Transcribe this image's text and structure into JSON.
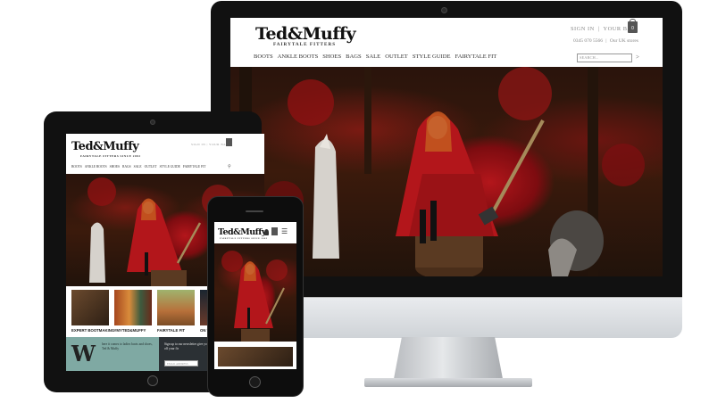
{
  "brand": {
    "logo": "Ted&Muffy",
    "tagline_desktop": "FAIRYTALE FITTERS",
    "tagline_tablet": "FAIRYTALE FITTERS SINCE 2002"
  },
  "desktop": {
    "account": {
      "sign_in": "SIGN IN",
      "separator": "|",
      "your_bag": "YOUR BAG",
      "bag_count": "0"
    },
    "phone_number": "0345 070 5566",
    "stores_link": "Our UK stores",
    "nav": [
      "BOOTS",
      "ANKLE BOOTS",
      "SHOES",
      "BAGS",
      "SALE",
      "OUTLET",
      "STYLE GUIDE",
      "FAIRYTALE FIT"
    ],
    "search_placeholder": "SEARCH...",
    "search_go": ">"
  },
  "tablet": {
    "account": "SIGN IN | YOUR BAG",
    "nav": [
      "BOOTS",
      "ANKLE BOOTS",
      "SHOES",
      "BAGS",
      "SALE",
      "OUTLET",
      "STYLE GUIDE",
      "FAIRYTALE FIT"
    ],
    "features": [
      {
        "caption": "EXPERT BOOTMAKING"
      },
      {
        "caption": "#MYTED&MUFFY"
      },
      {
        "caption": "FAIRYTALE FIT"
      },
      {
        "caption": "ON TR"
      }
    ],
    "promo_text": "here it comes to ladies boots and shoes, Ted & Muffy",
    "newsletter_text": "Sign up to our newsletter give you £50 off your fir",
    "newsletter_placeholder": "EMAIL ADDRESS"
  },
  "phone": {
    "logo": "Ted&Muffy",
    "tagline": "FAIRYTALE FITTERS SINCE 2002"
  },
  "colors": {
    "accent_red": "#b3161b",
    "promo_teal": "#7fa9a3",
    "dark_background": "#1a0d07"
  }
}
